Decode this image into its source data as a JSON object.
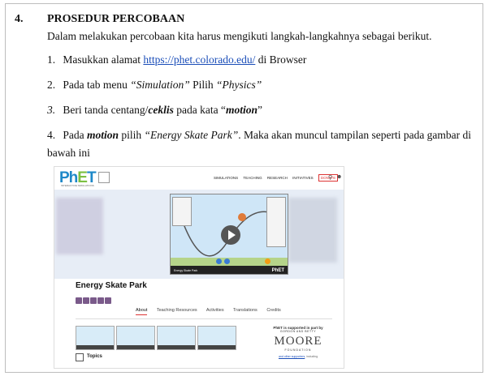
{
  "section": {
    "number": "4.",
    "title": "PROSEDUR PERCOBAAN"
  },
  "intro": "Dalam melakukan percobaan kita harus mengikuti langkah-langkahnya sebagai berikut.",
  "steps": [
    {
      "num": "1.",
      "pre": "Masukkan alamat ",
      "link": "https://phet.colorado.edu/",
      "post": " di Browser"
    },
    {
      "num": "2.",
      "pre": "Pada tab menu ",
      "it1": "“Simulation”",
      "mid": " Pilih ",
      "it2": "“Physics”"
    },
    {
      "num": "3.",
      "pre": " Beri tanda centang/",
      "it1": "ceklis",
      "mid": " pada kata “",
      "bi": "motion",
      "post": "”"
    },
    {
      "num": "4.",
      "pre": "Pada ",
      "it1": "motion",
      "mid": " pilih ",
      "it2": "“Energy Skate Park”",
      "post": ". Maka akan muncul tampilan seperti pada gambar di bawah ini"
    }
  ],
  "screenshot": {
    "logo": "PhET",
    "logo_sub": "INTERACTIVE SIMULATIONS",
    "nav": [
      "SIMULATIONS",
      "TEACHING",
      "RESEARCH",
      "INITIATIVES"
    ],
    "donate": "DONATE",
    "sim_label": "Energy Skate Park",
    "sim_brand": "PhET",
    "title": "Energy Skate Park",
    "tabs": [
      "About",
      "Teaching Resources",
      "Activities",
      "Translations",
      "Credits"
    ],
    "support_text": "PhET is supported in part by",
    "support_goar": "GORDON AND BETTY",
    "support_moore": "MOORE",
    "support_foundation": "FOUNDATION",
    "support_small_link": "and other supporters",
    "support_small_post": ", including",
    "topics": "Topics",
    "colors": {
      "accent": "#d33333",
      "brand_blue": "#1e88c8",
      "brand_green": "#7cc042"
    }
  }
}
